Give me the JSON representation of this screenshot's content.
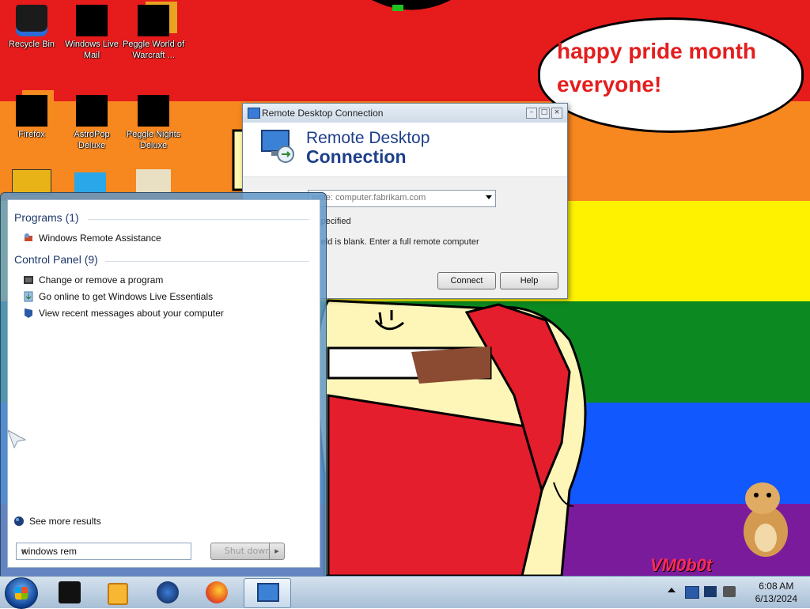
{
  "desktop": {
    "icons": [
      {
        "label": "Recycle Bin"
      },
      {
        "label": "Windows Live Mail"
      },
      {
        "label": "Peggle World of Warcraft ..."
      },
      {
        "label": "Firefox"
      },
      {
        "label": "AstroPop Deluxe"
      },
      {
        "label": "Peggle Nights Deluxe"
      }
    ],
    "speech_bubble": "happy pride month everyone!",
    "watermark": "VM0b0t"
  },
  "rdc_window": {
    "title": "Remote Desktop Connection",
    "banner_line1": "Remote Desktop",
    "banner_line2": "Connection",
    "computer_placeholder": "mple: computer.fabrikam.com",
    "user_text": "e specified",
    "note_text": "e field is blank. Enter a full remote computer",
    "connect_label": "Connect",
    "help_label": "Help"
  },
  "start_menu": {
    "programs_header": "Programs (1)",
    "programs": [
      {
        "label": "Windows Remote Assistance"
      }
    ],
    "control_panel_header": "Control Panel (9)",
    "control_panel": [
      {
        "label": "Change or remove a program"
      },
      {
        "label": "Go online to get Windows Live Essentials"
      },
      {
        "label": "View recent messages about your computer"
      }
    ],
    "see_more": "See more results",
    "search_value": "windows rem",
    "shutdown_label": "Shut down"
  },
  "taskbar": {
    "time": "6:08 AM",
    "date": "6/13/2024"
  },
  "colors": {
    "red": "#e61b1b",
    "orange": "#f7871f",
    "yellow": "#fef200",
    "green": "#0c8a21",
    "blue": "#1158ff",
    "purple": "#7a1b9c"
  }
}
